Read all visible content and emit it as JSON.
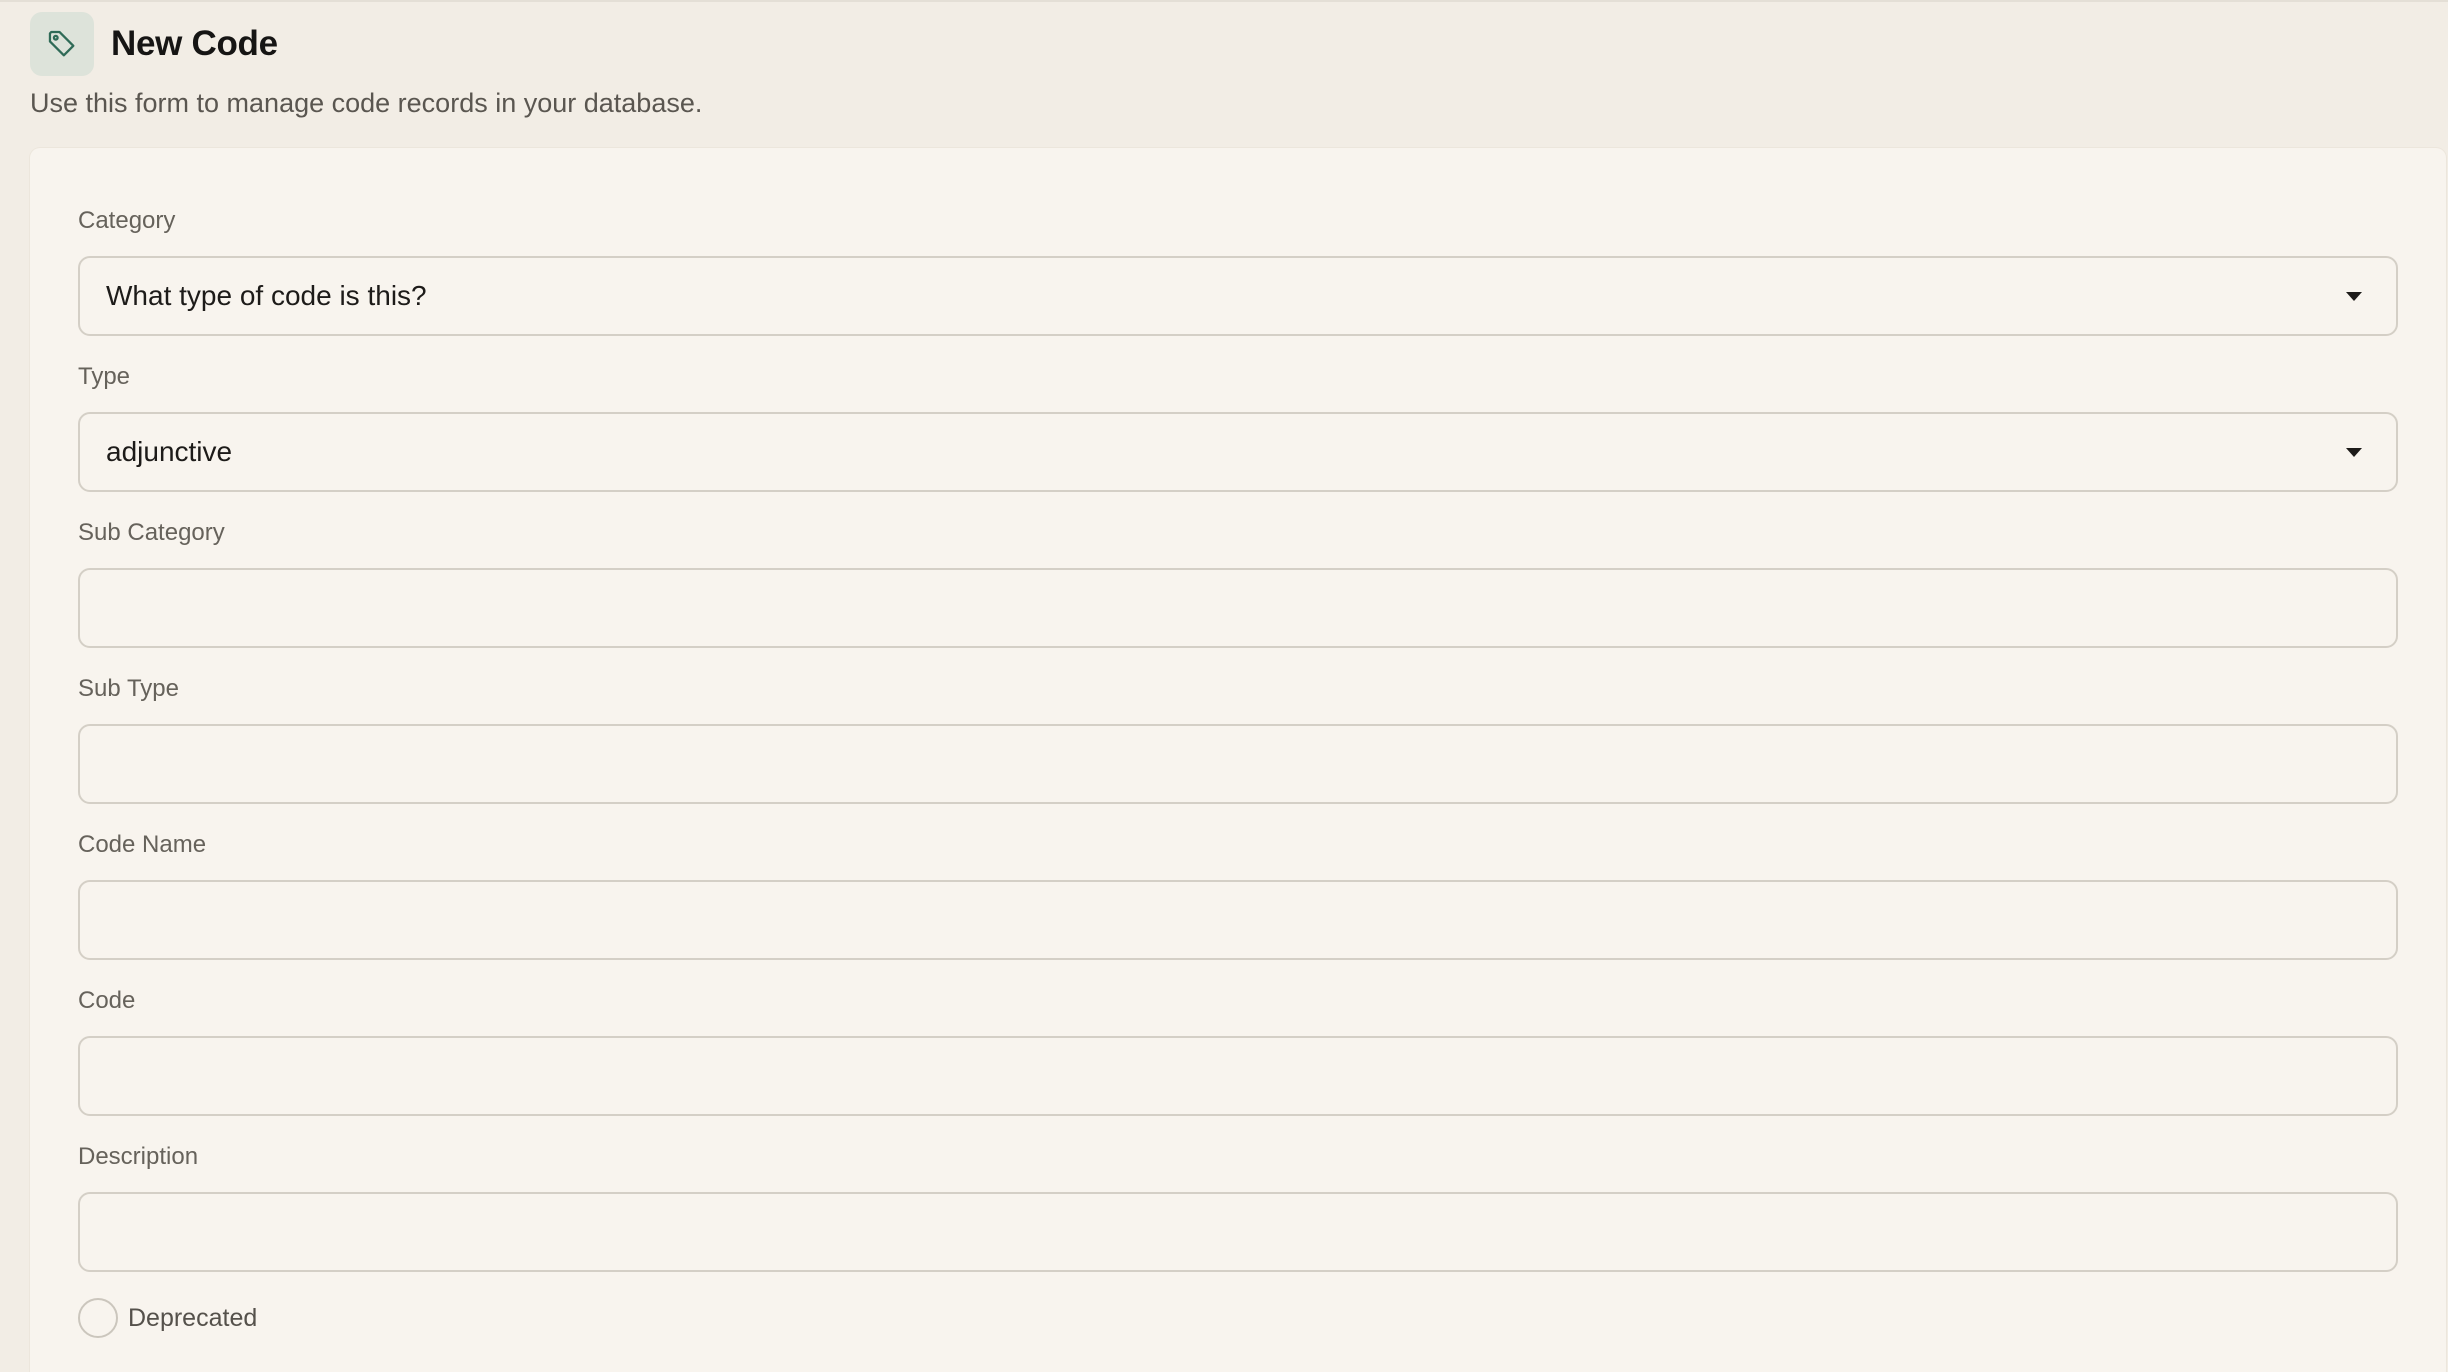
{
  "header": {
    "icon": "tag-icon",
    "title": "New Code",
    "subtitle": "Use this form to manage code records in your database."
  },
  "form": {
    "category": {
      "label": "Category",
      "placeholder": "What type of code is this?"
    },
    "type": {
      "label": "Type",
      "value": "adjunctive"
    },
    "sub_category": {
      "label": "Sub Category",
      "value": ""
    },
    "sub_type": {
      "label": "Sub Type",
      "value": ""
    },
    "code_name": {
      "label": "Code Name",
      "value": ""
    },
    "code": {
      "label": "Code",
      "value": ""
    },
    "description": {
      "label": "Description",
      "value": ""
    },
    "deprecated": {
      "label": "Deprecated",
      "checked": false
    }
  },
  "colors": {
    "page_bg": "#f2ede5",
    "card_bg": "#f8f4ee",
    "icon_badge": "#dde3da",
    "icon_stroke": "#2f6b57",
    "border": "#d4cfc6"
  }
}
